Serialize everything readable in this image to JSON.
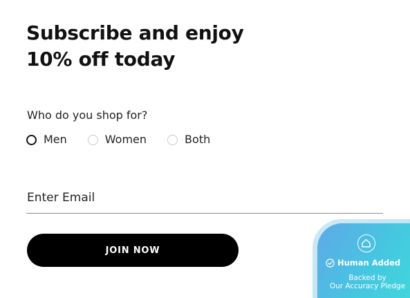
{
  "headline": {
    "line1": "Subscribe and enjoy",
    "line2": "10% off today"
  },
  "question": "Who do you shop for?",
  "shop_for_options": [
    {
      "label": "Men",
      "selected": true
    },
    {
      "label": "Women",
      "selected": false
    },
    {
      "label": "Both",
      "selected": false
    }
  ],
  "email": {
    "placeholder": "Enter Email",
    "value": ""
  },
  "join_button_label": "JOIN NOW",
  "badge": {
    "title": "Human Added",
    "line1": "Backed by",
    "line2": "Our Accuracy Pledge",
    "house_icon": "house-outline-icon",
    "check_icon": "check-circle-icon"
  },
  "colors": {
    "text": "#111111",
    "button_bg": "#000000",
    "button_text": "#ffffff",
    "badge_gradient_start": "#5ea9e8",
    "badge_gradient_end": "#40dadc"
  }
}
